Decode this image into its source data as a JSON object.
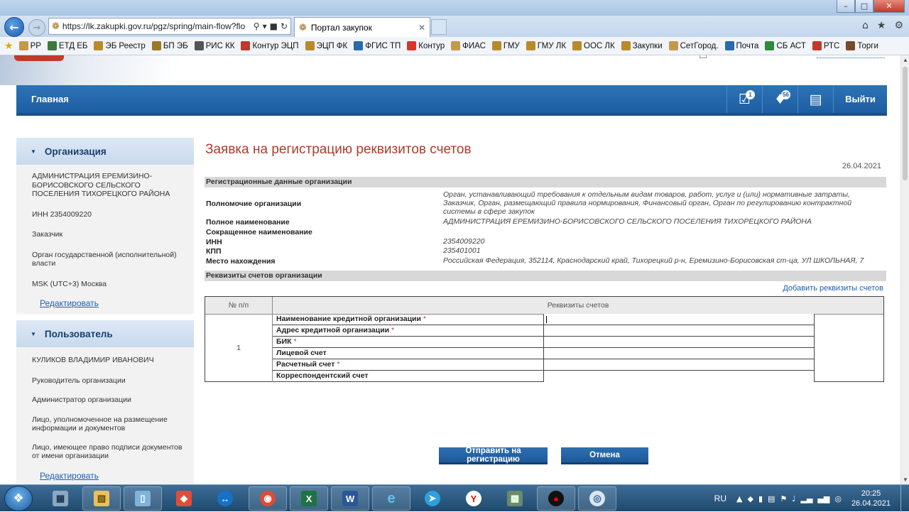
{
  "browser": {
    "url": "https://lk.zakupki.gov.ru/pgz/spring/main-flow?flo",
    "tab_title": "Портал закупок",
    "bookmarks": [
      "РР",
      "ЕТД ЕБ",
      "ЭБ Реестр",
      "БП ЭБ",
      "РИС КК",
      "Контур ЭЦП",
      "ЭЦП ФК",
      "ФГИС ТП",
      "Контур",
      "ФИАС",
      "ГМУ",
      "ГМУ ЛК",
      "ООС ЛК",
      "Закупки",
      "СетГород.",
      "Почта",
      "СБ АСТ",
      "РТС",
      "Торги"
    ]
  },
  "nav": {
    "home": "Главная",
    "calendar_badge": "1",
    "bell_badge": "56",
    "logout": "Выйти"
  },
  "sidebar": {
    "org": {
      "title": "Организация",
      "name": "АДМИНИСТРАЦИЯ ЕРЕМИЗИНО-БОРИСОВСКОГО СЕЛЬСКОГО ПОСЕЛЕНИЯ ТИХОРЕЦКОГО РАЙОНА",
      "inn": "ИНН 2354009220",
      "role": "Заказчик",
      "type": "Орган государственной (исполнительной) власти",
      "tz": "MSK (UTC+3) Москва",
      "edit": "Редактировать"
    },
    "user": {
      "title": "Пользователь",
      "name": "КУЛИКОВ ВЛАДИМИР ИВАНОВИЧ",
      "roles": [
        "Руководитель организации",
        "Администратор организации",
        "Лицо, уполномоченное на размещение информации и документов",
        "Лицо, имеющее право подписи документов от имени организации"
      ],
      "edit": "Редактировать"
    }
  },
  "main": {
    "title": "Заявка на регистрацию реквизитов счетов",
    "date": "26.04.2021",
    "sec_reg": "Регистрационные данные организации",
    "rows": [
      {
        "label": "Полномочие организации",
        "value": "Орган, устанавливающий требования к отдельным видам товаров, работ, услуг и (или) нормативные затраты, Заказчик, Орган, размещающий правила нормирования, Финансовый орган, Орган по регулированию контрактной системы в сфере закупок"
      },
      {
        "label": "Полное наименование",
        "value": "АДМИНИСТРАЦИЯ ЕРЕМИЗИНО-БОРИСОВСКОГО СЕЛЬСКОГО ПОСЕЛЕНИЯ ТИХОРЕЦКОГО РАЙОНА"
      },
      {
        "label": "Сокращенное наименование",
        "value": ""
      },
      {
        "label": "ИНН",
        "value": "2354009220"
      },
      {
        "label": "КПП",
        "value": "235401001"
      },
      {
        "label": "Место нахождения",
        "value": "Российская Федерация, 352114, Краснодарский край, Тихорецкий р-н, Еремизино-Борисовская ст-ца, УЛ ШКОЛЬНАЯ, 7"
      }
    ],
    "sec_acc": "Реквизиты счетов организации",
    "add_link": "Добавить реквизиты счетов",
    "table": {
      "col_num": "№ п/п",
      "col_req": "Реквизиты счетов",
      "row_num": "1",
      "fields": [
        {
          "label": "Наименование кредитной организации",
          "required": "*",
          "value": ""
        },
        {
          "label": "Адрес кредитной организации",
          "required": "*",
          "value": ""
        },
        {
          "label": "БИК",
          "required": "*",
          "value": ""
        },
        {
          "label": "Лицевой счет",
          "required": "",
          "value": ""
        },
        {
          "label": "Расчетный счет",
          "required": "*",
          "value": ""
        },
        {
          "label": "Корреспондентский счет",
          "required": "",
          "value": ""
        }
      ]
    },
    "submit": "Отправить на регистрацию",
    "cancel": "Отмена"
  },
  "taskbar": {
    "lang": "RU",
    "time": "20:25",
    "date": "26.04.2021"
  }
}
